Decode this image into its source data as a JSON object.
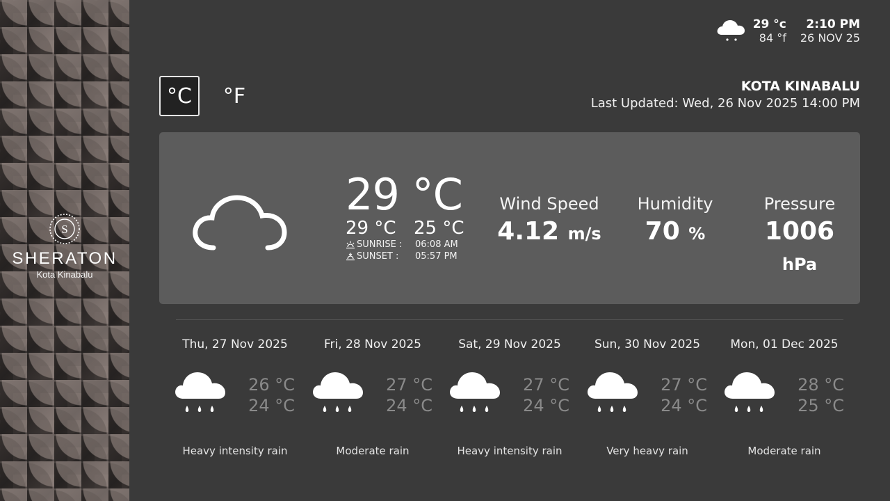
{
  "brand": {
    "name": "SHERATON",
    "subtitle": "Kota Kinabalu",
    "logo_letter": "S"
  },
  "topbar": {
    "icon": "cloud-rain-icon",
    "temp_c": "29 °c",
    "temp_f": "84 °f",
    "time": "2:10 PM",
    "date": "26 NOV 25"
  },
  "units": {
    "celsius": "°C",
    "fahrenheit": "°F",
    "selected": "celsius"
  },
  "location": {
    "name": "KOTA KINABALU",
    "last_updated": "Last Updated: Wed, 26 Nov 2025 14:00 PM"
  },
  "current": {
    "icon": "cloud-outline-icon",
    "temp": "29 °C",
    "high": "29 °C",
    "low": "25 °C",
    "sunrise_label": "SUNRISE :",
    "sunrise": "06:08 AM",
    "sunset_label": "SUNSET  :",
    "sunset": "05:57 PM",
    "wind": {
      "label": "Wind Speed",
      "value": "4.12",
      "unit": "m/s"
    },
    "humidity": {
      "label": "Humidity",
      "value": "70",
      "unit": "%"
    },
    "pressure": {
      "label": "Pressure",
      "value": "1006",
      "unit": "hPa"
    }
  },
  "forecast": [
    {
      "date": "Thu, 27 Nov 2025",
      "high": "26 °C",
      "low": "24 °C",
      "desc": "Heavy intensity rain",
      "icon": "cloud-rain-icon"
    },
    {
      "date": "Fri, 28 Nov 2025",
      "high": "27 °C",
      "low": "24 °C",
      "desc": "Moderate rain",
      "icon": "cloud-rain-icon"
    },
    {
      "date": "Sat, 29 Nov 2025",
      "high": "27 °C",
      "low": "24 °C",
      "desc": "Heavy intensity rain",
      "icon": "cloud-rain-icon"
    },
    {
      "date": "Sun, 30 Nov 2025",
      "high": "27 °C",
      "low": "24 °C",
      "desc": "Very heavy rain",
      "icon": "cloud-rain-icon"
    },
    {
      "date": "Mon, 01 Dec 2025",
      "high": "28 °C",
      "low": "25 °C",
      "desc": "Moderate rain",
      "icon": "cloud-rain-icon"
    }
  ],
  "colors": {
    "background": "#3a3a3a",
    "card": "#5c5c5c",
    "muted_temp": "#8a8a8a"
  }
}
